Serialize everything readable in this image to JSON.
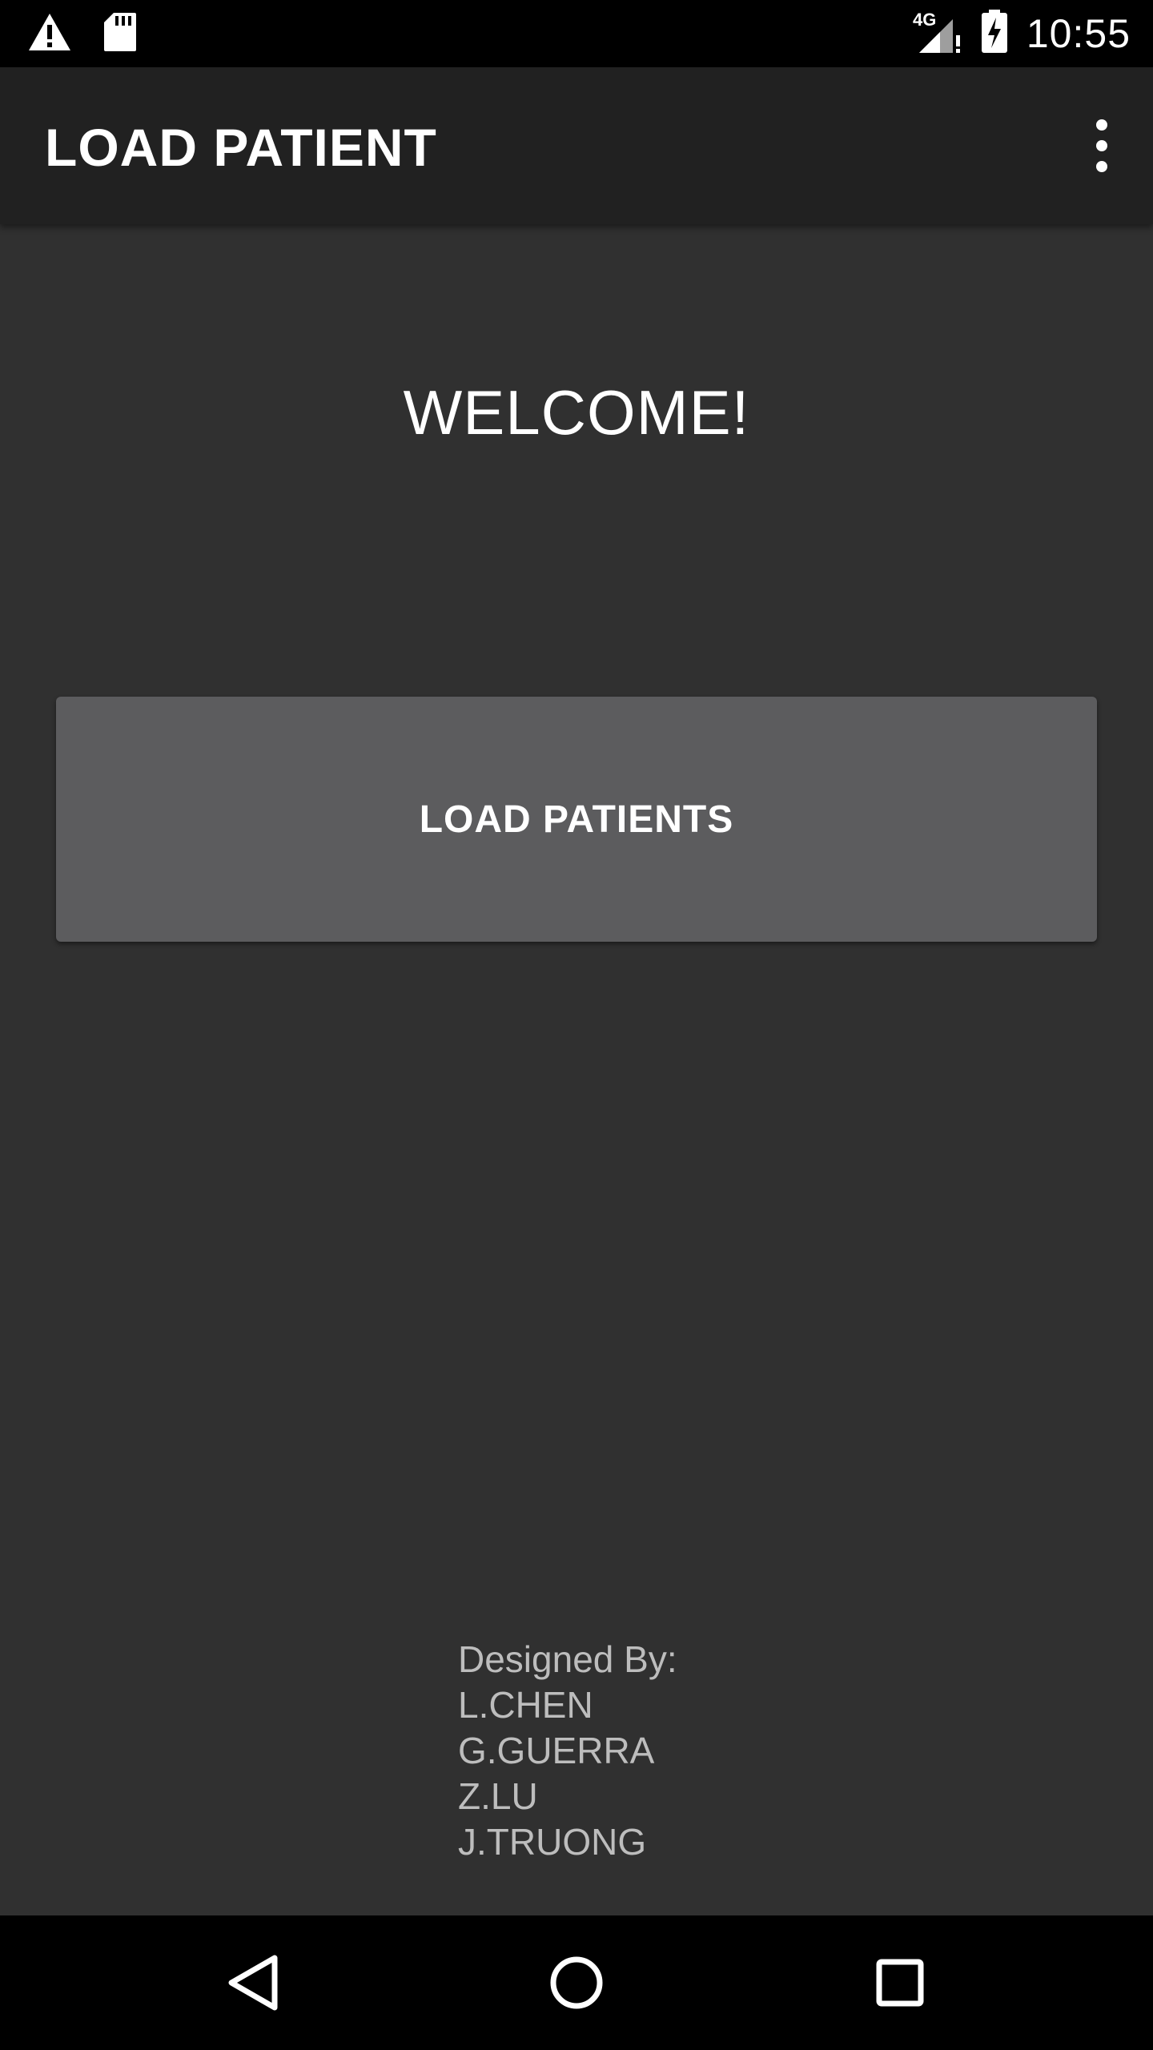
{
  "status_bar": {
    "time": "10:55",
    "network_label": "4G",
    "icons": [
      "warning-icon",
      "sd-card-icon",
      "signal-icon",
      "battery-charging-icon"
    ]
  },
  "app_bar": {
    "title": "LOAD PATIENT",
    "menu_icon": "more-vert-icon"
  },
  "main": {
    "welcome_text": "WELCOME!",
    "load_button_label": "LOAD PATIENTS"
  },
  "credits": {
    "heading": "Designed By:",
    "names": [
      "L.CHEN",
      "G.GUERRA",
      "Z.LU",
      "J.TRUONG"
    ]
  },
  "nav_bar": {
    "icons": [
      "back-icon",
      "home-icon",
      "recents-icon"
    ]
  },
  "colors": {
    "background": "#303030",
    "app_bar": "#212121",
    "button": "#5c5c5e",
    "credits_text": "#bdbdbd"
  }
}
